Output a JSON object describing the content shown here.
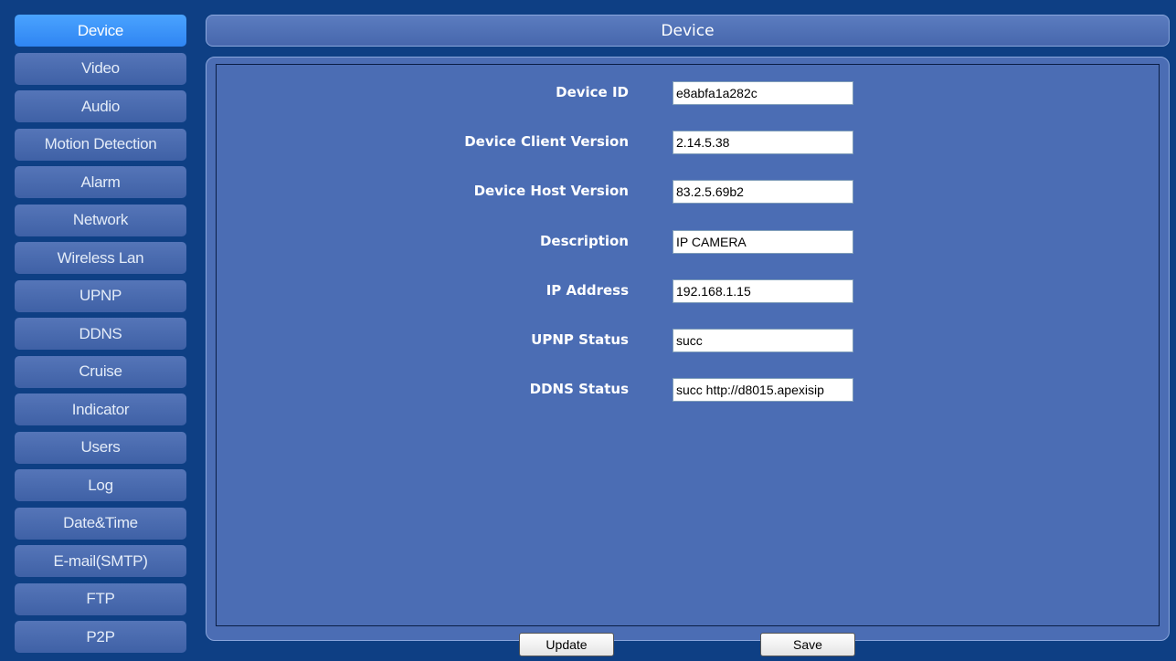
{
  "sidebar": {
    "items": [
      {
        "label": "Device",
        "active": true
      },
      {
        "label": "Video"
      },
      {
        "label": "Audio"
      },
      {
        "label": "Motion Detection"
      },
      {
        "label": "Alarm"
      },
      {
        "label": "Network"
      },
      {
        "label": "Wireless Lan"
      },
      {
        "label": "UPNP"
      },
      {
        "label": "DDNS"
      },
      {
        "label": "Cruise"
      },
      {
        "label": "Indicator"
      },
      {
        "label": "Users"
      },
      {
        "label": "Log"
      },
      {
        "label": "Date&Time"
      },
      {
        "label": "E-mail(SMTP)"
      },
      {
        "label": "FTP"
      },
      {
        "label": "P2P"
      }
    ]
  },
  "header": {
    "title": "Device"
  },
  "fields": [
    {
      "label": "Device ID",
      "value": "e8abfa1a282c"
    },
    {
      "label": "Device Client Version",
      "value": "2.14.5.38"
    },
    {
      "label": "Device Host Version",
      "value": "83.2.5.69b2"
    },
    {
      "label": "Description",
      "value": "IP CAMERA"
    },
    {
      "label": "IP Address",
      "value": "192.168.1.15"
    },
    {
      "label": "UPNP Status",
      "value": "succ"
    },
    {
      "label": "DDNS Status",
      "value": "succ http://d8015.apexisip"
    }
  ],
  "buttons": {
    "update": "Update",
    "save": "Save"
  },
  "colors": {
    "page_background": "#0e3f84",
    "panel": "#4b6db4",
    "active_tab": "#2f85f2"
  }
}
